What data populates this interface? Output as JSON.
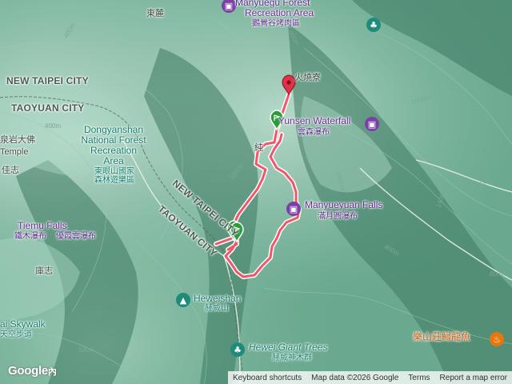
{
  "map": {
    "regions": {
      "new_taipei_nw": "NEW TAIPEI CITY",
      "taoyuan_nw": "TAOYUAN CITY",
      "new_taipei_diag": "NEW TAIPEI CITY",
      "taoyuan_diag": "TAOYUAN CITY"
    },
    "places": {
      "donglu": "東麓",
      "huoshaoliao": "火燒寮",
      "jiazhi": "佳志",
      "lianzhi": "庫志",
      "xinjie": "純",
      "top_rec_en": "Recreation Area",
      "top_rec_zh": "鵝鶯谷烤肉區",
      "top_rec_cut": "Manyuegu Forest"
    },
    "pois": {
      "dongyanshan_en": "Dongyanshan National Forest Recreation Area",
      "dongyanshan_line1": "Dongyanshan",
      "dongyanshan_line2": "National Forest",
      "dongyanshan_line3": "Recreation",
      "dongyanshan_line4": "Area",
      "dongyanshan_zh1": "東眼山國家",
      "dongyanshan_zh2": "森林遊樂區",
      "yunsen_en": "Yunsen Waterfall",
      "yunsen_zh": "雲森瀑布",
      "manyueyuan_en": "Manyueyuan Falls",
      "manyueyuan_zh": "滿月圓瀑布",
      "tiemu_en": "Tiemu Falls",
      "tiemu_zh": "鐵木瀑布",
      "youxia_zh": "優霞雲瀑布",
      "heweishan_en": "Heweishan",
      "heweishan_zh": "赫威山",
      "hewei_trees_en": "Hewei Giant Trees",
      "hewei_trees_zh": "赫威神木群",
      "skywalk_en": "ai Skywalk",
      "skywalk_zh": "天空步道",
      "restaurant_zh": "樂山莊鱘龍魚",
      "temple_cut": "Temple",
      "temple_zh": "泉岩大佛"
    },
    "contours": [
      "400m",
      "400m",
      "800m",
      "1000m",
      "1000m",
      "1000m",
      "1200m",
      "1200m",
      "1400m",
      "600m",
      "800m",
      "800m"
    ],
    "colors": {
      "track": "#f0566a",
      "track_outline": "#ffffff",
      "start_pin": "#2a9d3a",
      "end_pin": "#e0334a",
      "terrain": "#5f9e85",
      "poi_purple": "#7b3fa6",
      "poi_teal": "#1e8c7a",
      "poi_orange": "#e8760a"
    }
  },
  "footer": {
    "shortcuts": "Keyboard shortcuts",
    "map_data": "Map data ©2026 Google",
    "terms": "Terms",
    "report": "Report a map error"
  },
  "brand": {
    "google": "Google",
    "lang": "內"
  }
}
